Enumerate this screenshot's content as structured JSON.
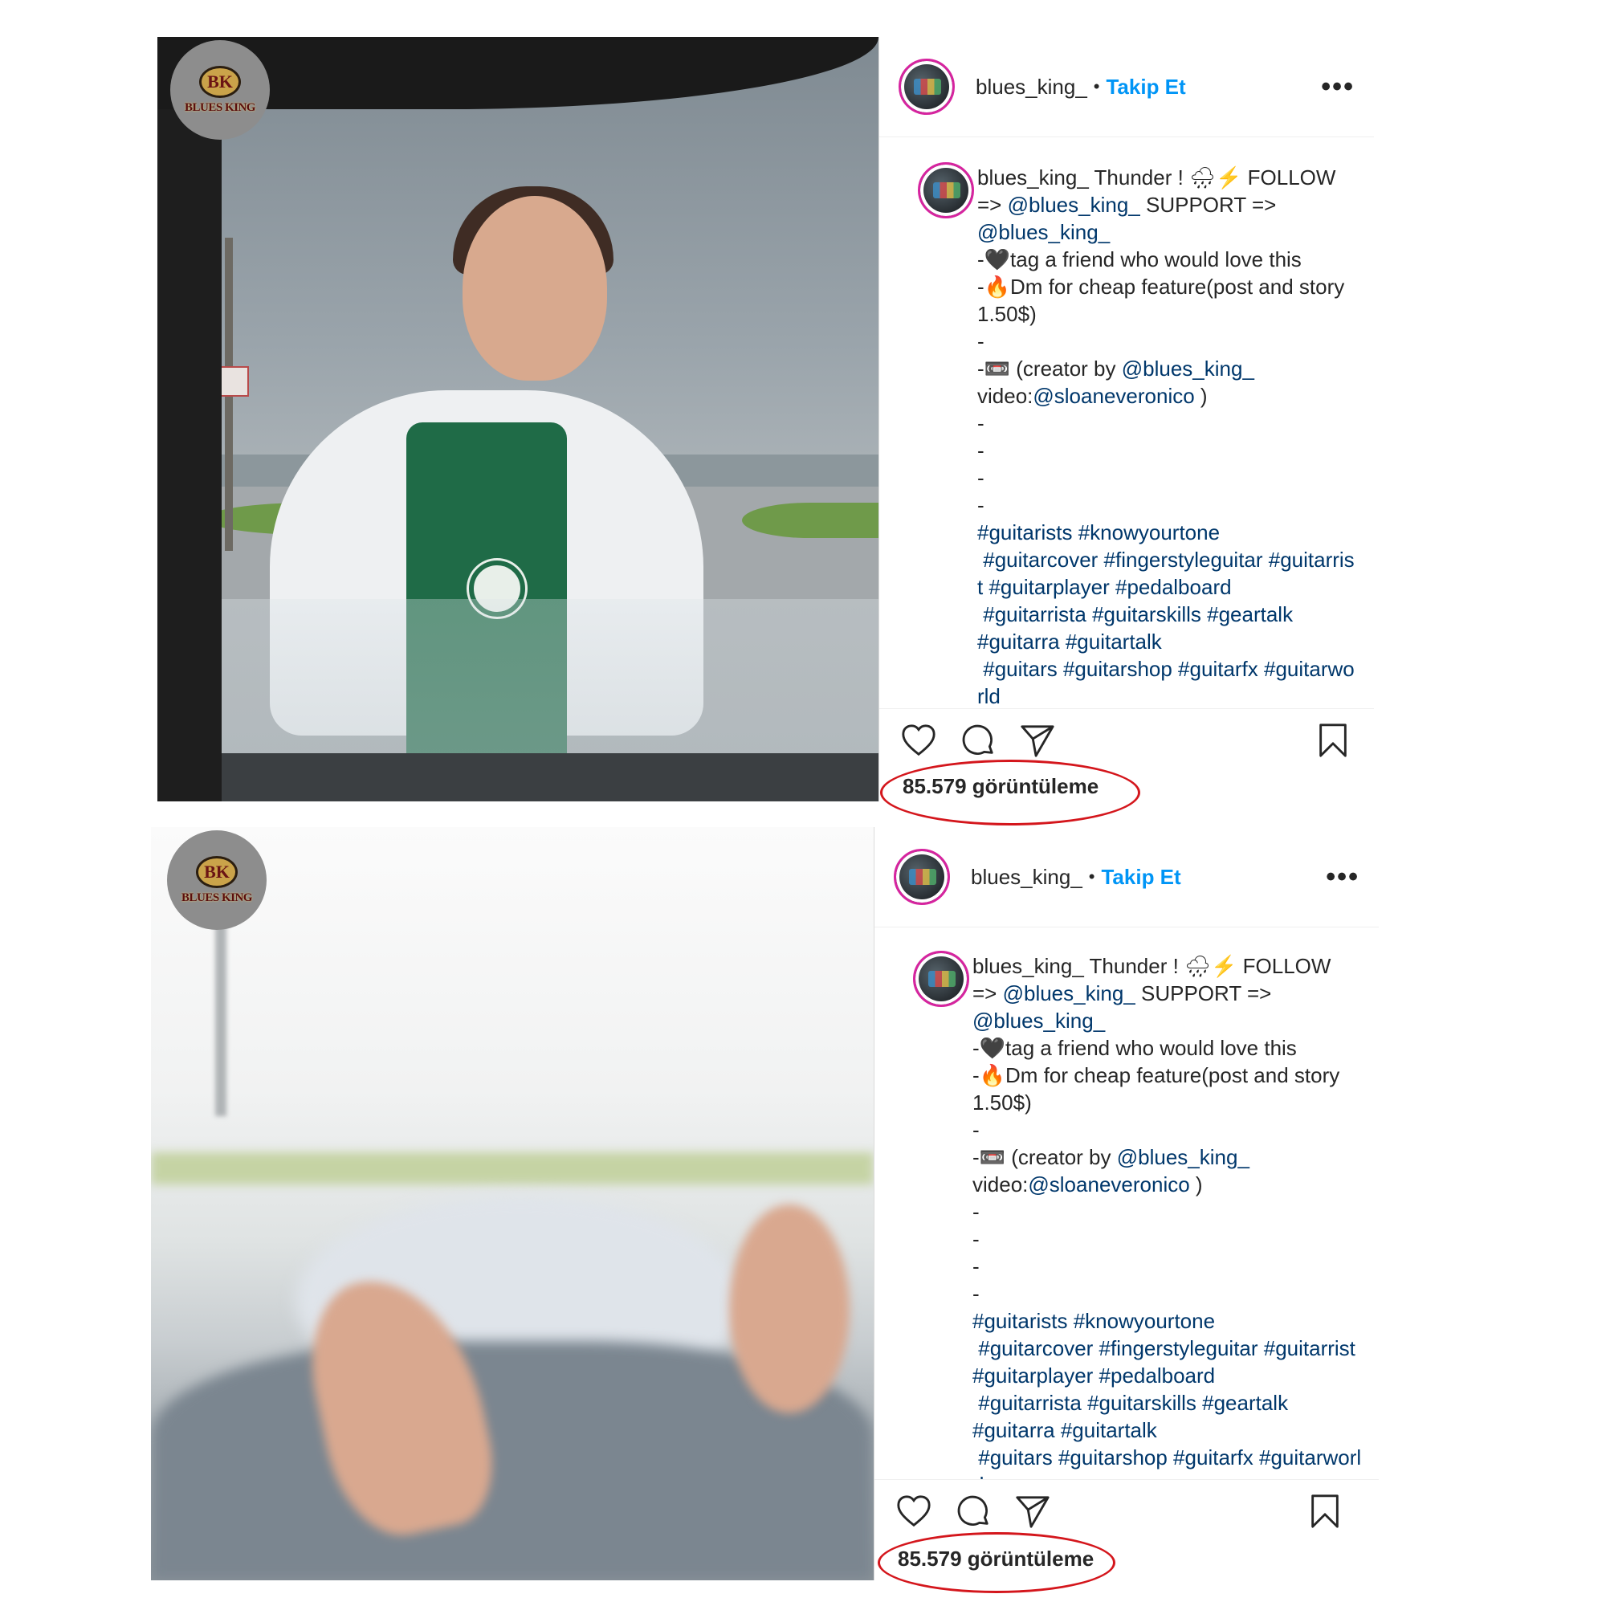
{
  "posts": [
    {
      "logo": {
        "badge": "BK",
        "name": "BLUES KING"
      },
      "header": {
        "username": "blues_king_",
        "separator": "•",
        "follow_label": "Takip Et",
        "more_label": "•••"
      },
      "caption": {
        "username": "blues_king_",
        "line1_text": " Thunder ! 🌧⚡ FOLLOW\n=> ",
        "mention1": "@blues_king_",
        "line2_text": " SUPPORT =>\n",
        "mention2": "@blues_king_",
        "line3_text": "\n-🖤tag a friend who would love this\n-🔥Dm for cheap feature(post and story 1.50$)\n-\n-📼 (creator by ",
        "mention3": "@blues_king_",
        "line4_text": "\nvideo:",
        "mention4": "@sloaneveronico",
        "line5_text": " )\n-\n-\n-\n-\n",
        "hashtags": "#guitarists #knowyourtone\n #guitarcover #fingerstyleguitar #guitarrist #guitarplayer #pedalboard\n #guitarrista #guitarskills #geartalk\n#guitarra #guitartalk\n #guitars #guitarshop #guitarfx #guitarworld"
      },
      "views": "85.579 görüntüleme"
    },
    {
      "logo": {
        "badge": "BK",
        "name": "BLUES KING"
      },
      "header": {
        "username": "blues_king_",
        "separator": "•",
        "follow_label": "Takip Et",
        "more_label": "•••"
      },
      "caption": {
        "username": "blues_king_",
        "line1_text": " Thunder ! 🌧⚡ FOLLOW\n=> ",
        "mention1": "@blues_king_",
        "line2_text": " SUPPORT =>\n",
        "mention2": "@blues_king_",
        "line3_text": "\n-🖤tag a friend who would love this\n-🔥Dm for cheap feature(post and story 1.50$)\n-\n-📼 (creator by ",
        "mention3": "@blues_king_",
        "line4_text": "\nvideo:",
        "mention4": "@sloaneveronico",
        "line5_text": " )\n-\n-\n-\n-\n",
        "hashtags": "#guitarists #knowyourtone\n #guitarcover #fingerstyleguitar #guitarrist #guitarplayer #pedalboard\n #guitarrista #guitarskills #geartalk\n#guitarra #guitartalk\n #guitars #guitarshop #guitarfx #guitarworld"
      },
      "views": "85.579 görüntüleme"
    }
  ],
  "icons": [
    "heart-icon",
    "comment-icon",
    "share-icon",
    "bookmark-icon",
    "more-icon"
  ],
  "colors": {
    "link": "#00376b",
    "follow": "#0095f6",
    "highlight": "#d4161c"
  }
}
